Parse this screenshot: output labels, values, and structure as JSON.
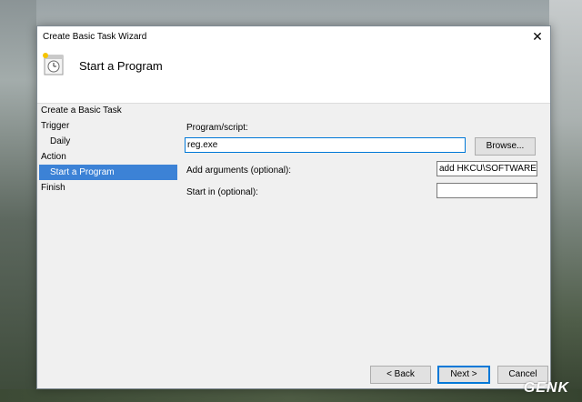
{
  "window": {
    "title": "Create Basic Task Wizard",
    "header_title": "Start a Program"
  },
  "steps": [
    {
      "label": "Create a Basic Task"
    },
    {
      "label": "Trigger"
    },
    {
      "label": "Daily"
    },
    {
      "label": "Action"
    },
    {
      "label": "Start a Program"
    },
    {
      "label": "Finish"
    }
  ],
  "form": {
    "program_label": "Program/script:",
    "program_value": "reg.exe",
    "browse_label": "Browse...",
    "args_label": "Add arguments (optional):",
    "args_value": "add HKCU\\SOFTWARE\\M",
    "startin_label": "Start in (optional):",
    "startin_value": ""
  },
  "buttons": {
    "back": "< Back",
    "next": "Next >",
    "cancel": "Cancel"
  },
  "icons": {
    "close": "close-icon",
    "wizard": "task-clock-icon"
  },
  "watermark": "GENK",
  "colors": {
    "selection": "#3c82d6",
    "focus_border": "#0078d7"
  }
}
